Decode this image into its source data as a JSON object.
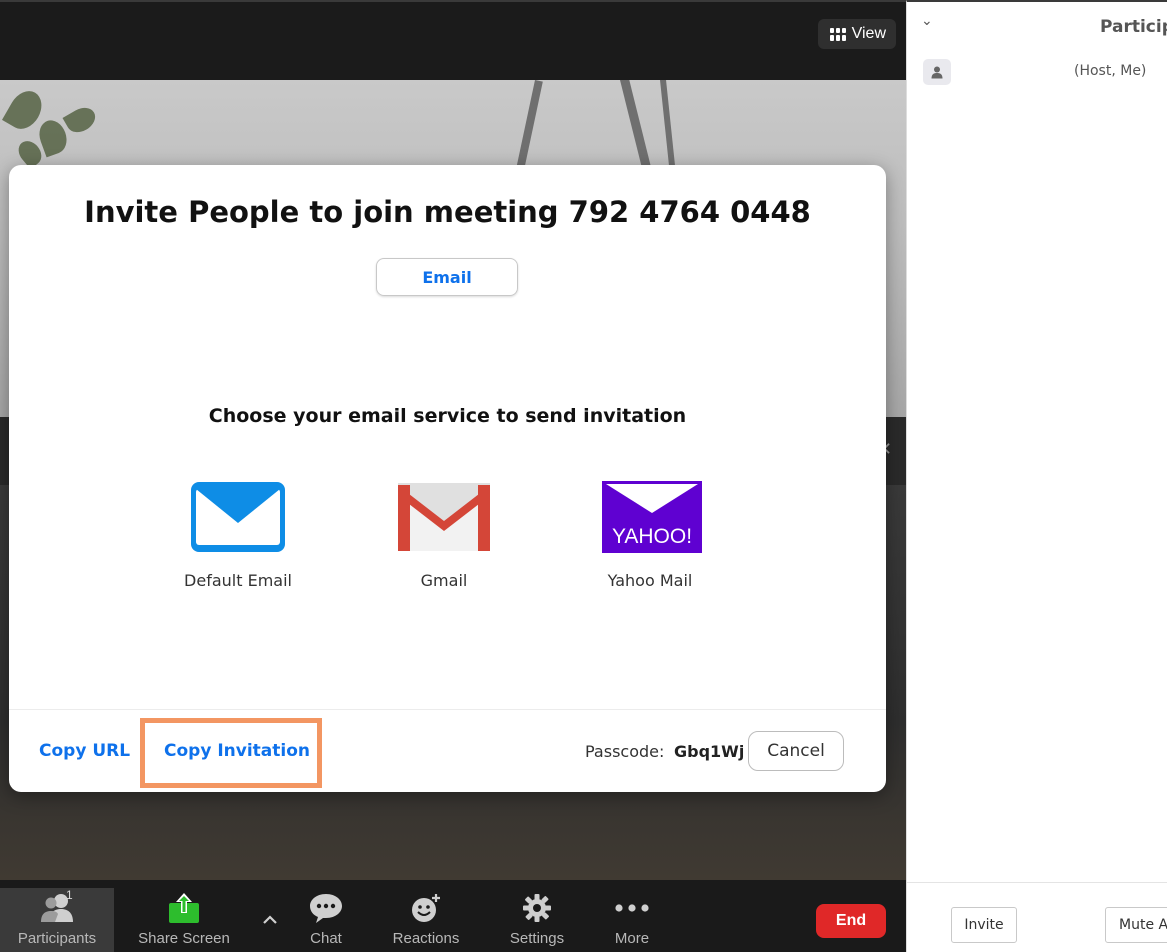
{
  "top_bar": {
    "view_label": "View"
  },
  "dialog": {
    "title": "Invite People to join meeting 792 4764 0448",
    "tab_email": "Email",
    "choose_label": "Choose your email service to send invitation",
    "services": [
      {
        "name": "Default Email",
        "icon": "mail-envelope-icon"
      },
      {
        "name": "Gmail",
        "icon": "gmail-icon"
      },
      {
        "name": "Yahoo Mail",
        "icon": "yahoo-icon",
        "logo_text": "YAHOO!"
      }
    ],
    "copy_url": "Copy URL",
    "copy_invitation": "Copy Invitation",
    "passcode_label": "Passcode:",
    "passcode_value": "Gbq1Wj",
    "cancel": "Cancel"
  },
  "toolbar": {
    "participants": "Participants",
    "participants_count": "1",
    "share_screen": "Share Screen",
    "chat": "Chat",
    "reactions": "Reactions",
    "settings": "Settings",
    "more": "More",
    "end": "End"
  },
  "panel": {
    "title": "Particip",
    "participant_name": "(Host, Me)",
    "invite": "Invite",
    "mute_all": "Mute A"
  },
  "colors": {
    "accent_blue": "#0e71eb",
    "end_red": "#e02828",
    "highlight_orange": "#f39662",
    "share_green": "#2dbd2d",
    "yahoo_purple": "#5f01d1"
  }
}
